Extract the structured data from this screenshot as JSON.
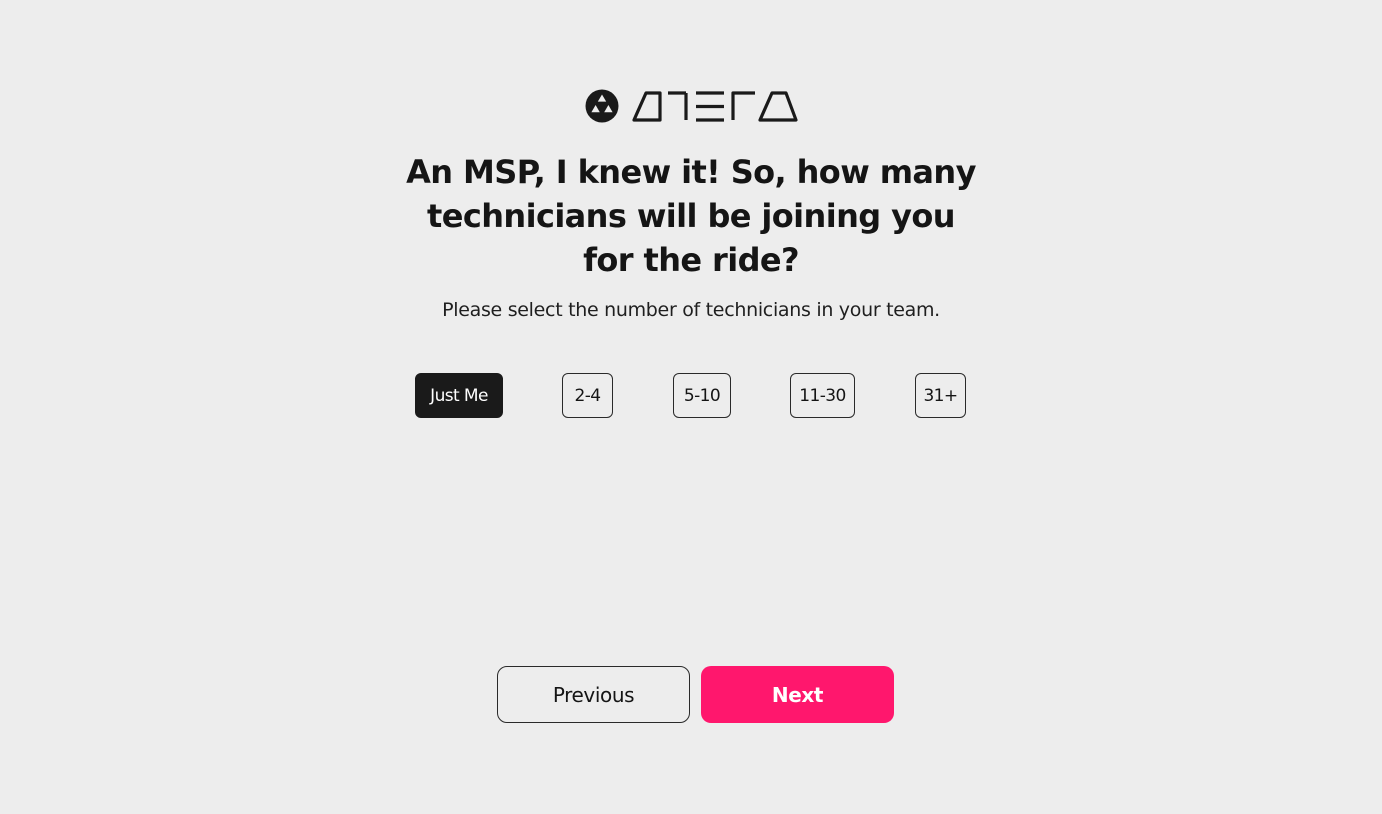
{
  "brand": {
    "logo_text": "ATERA",
    "logo_icon": "triangle-cluster-logo-icon"
  },
  "question": {
    "headline_line1": "An MSP, I knew it! So, how many",
    "headline_line2": "technicians will be joining you",
    "headline_line3": "for the ride?",
    "subtitle": "Please select the number of technicians in your team."
  },
  "options": [
    {
      "label": "Just Me",
      "selected": true
    },
    {
      "label": "2-4",
      "selected": false
    },
    {
      "label": "5-10",
      "selected": false
    },
    {
      "label": "11-30",
      "selected": false
    },
    {
      "label": "31+",
      "selected": false
    }
  ],
  "navigation": {
    "previous_label": "Previous",
    "next_label": "Next"
  },
  "colors": {
    "background": "#ededed",
    "text": "#151515",
    "selected_option": "#1a1a1a",
    "accent": "#ff176d"
  }
}
